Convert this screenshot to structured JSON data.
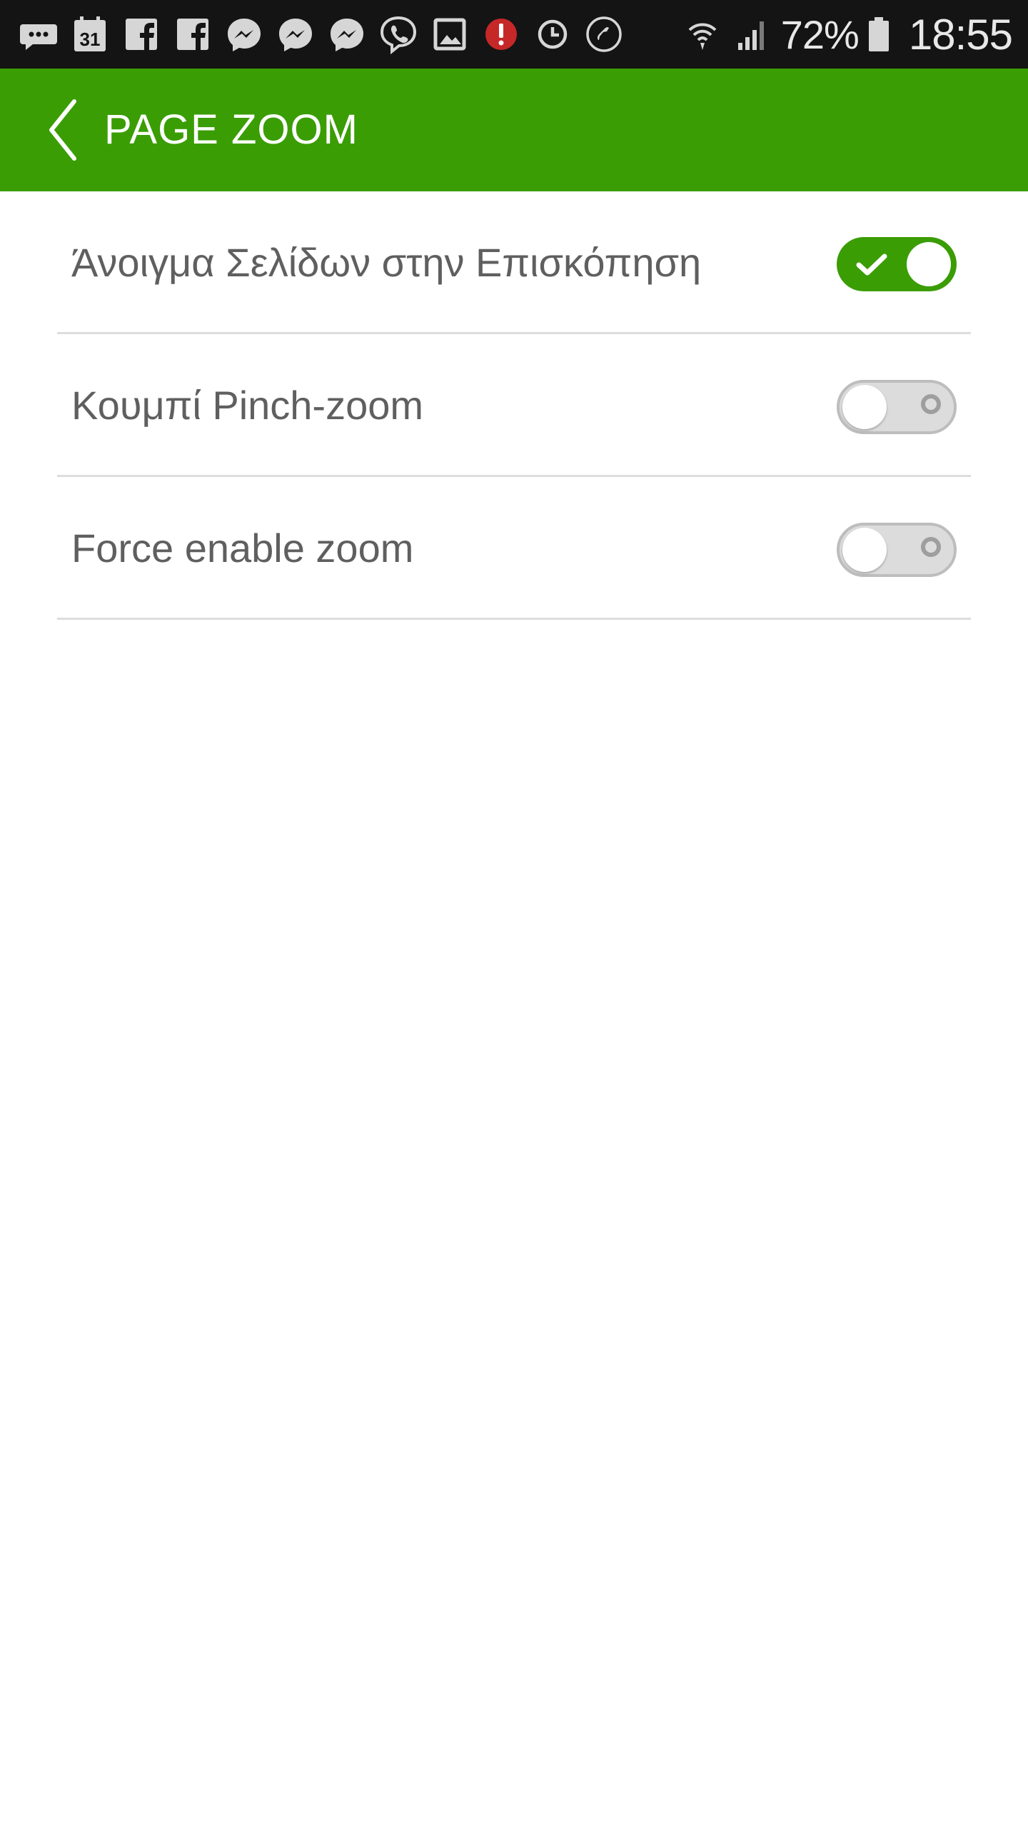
{
  "status_bar": {
    "notification_icons": [
      "more-messages-icon",
      "calendar-icon",
      "facebook-icon",
      "facebook-icon",
      "messenger-icon",
      "messenger-icon",
      "messenger-icon",
      "viber-icon",
      "gallery-icon",
      "alert-icon",
      "alarm-icon",
      "phone-icon"
    ],
    "calendar_day": "31",
    "battery_percent": "72%",
    "time": "18:55"
  },
  "app_bar": {
    "title": "PAGE ZOOM",
    "back_icon": "chevron-left-icon",
    "color": "#3a9d04"
  },
  "settings": [
    {
      "label": "Άνοιγμα Σελίδων στην Επισκόπηση",
      "enabled": true
    },
    {
      "label": "Κουμπί Pinch-zoom",
      "enabled": false
    },
    {
      "label": "Force enable zoom",
      "enabled": false
    }
  ],
  "colors": {
    "accent": "#3a9d04",
    "toggle_off": "#dcdcdc",
    "label_text": "#5f5f5f"
  }
}
